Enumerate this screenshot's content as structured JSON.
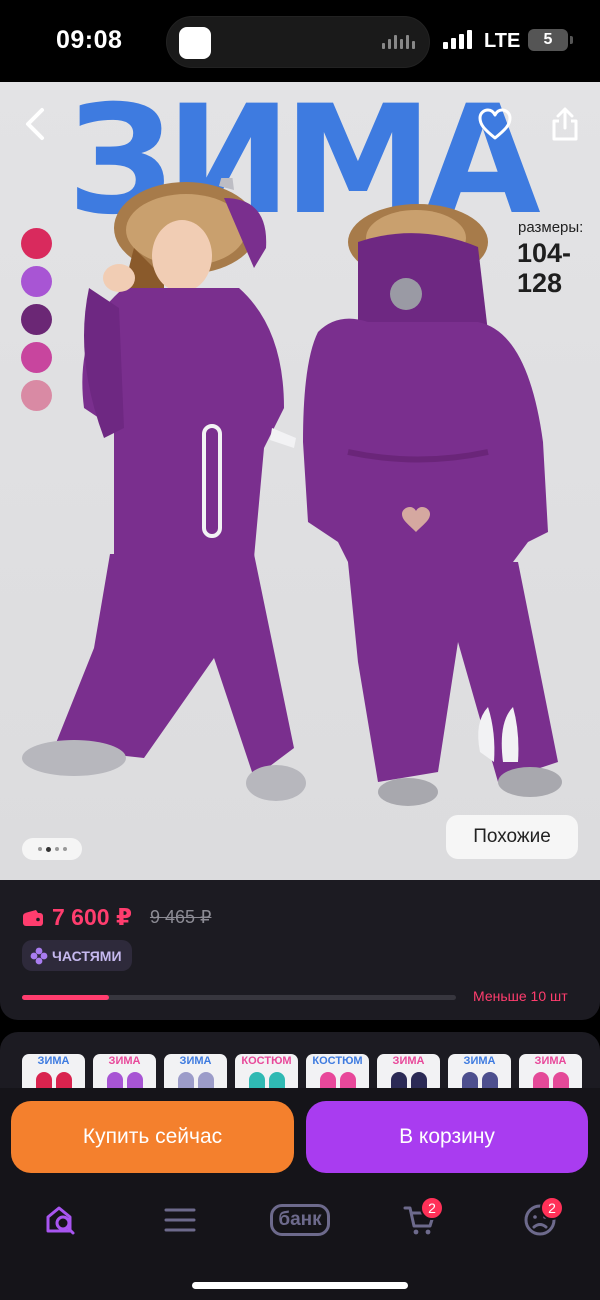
{
  "status_bar": {
    "time": "09:08",
    "network": "LTE",
    "battery": "5"
  },
  "hero": {
    "brand": "ЗИМА",
    "sizes_label": "размеры:",
    "sizes_value": "104-128",
    "similar_label": "Похожие",
    "gallery_dots": 4,
    "gallery_active_index": 1,
    "swatches": [
      "#d92a5d",
      "#a855d4",
      "#6b2775",
      "#c8459e",
      "#d98aa4"
    ],
    "suit_color": "#7a2f8e"
  },
  "price": {
    "current": "7 600 ₽",
    "old": "9 465 ₽",
    "installment": "ЧАСТЯМИ",
    "stock_text": "Меньше 10 шт",
    "stock_level": 0.2
  },
  "thumbnails": [
    {
      "title": "ЗИМА",
      "color": "#d9234e"
    },
    {
      "title": "ЗИМА",
      "color": "#a855d4"
    },
    {
      "title": "ЗИМА",
      "color": "#9c9cc9"
    },
    {
      "title": "КОСТЮМ",
      "color": "#2fb9b3"
    },
    {
      "title": "КОСТЮМ",
      "color": "#e8489a"
    },
    {
      "title": "ЗИМА",
      "color": "#2b2a55"
    },
    {
      "title": "ЗИМА",
      "color": "#4d4f8e"
    },
    {
      "title": "ЗИМА",
      "color": "#e44a98"
    }
  ],
  "actions": {
    "buy_now": "Купить сейчас",
    "add_to_cart": "В корзину"
  },
  "nav": {
    "bank_label": "банк",
    "cart_badge": "2",
    "profile_badge": "2"
  },
  "colors": {
    "accent_pink": "#ff3d6e",
    "buy_orange": "#f4802d",
    "cart_purple": "#a93cf0",
    "brand_blue": "#3e7be0"
  }
}
